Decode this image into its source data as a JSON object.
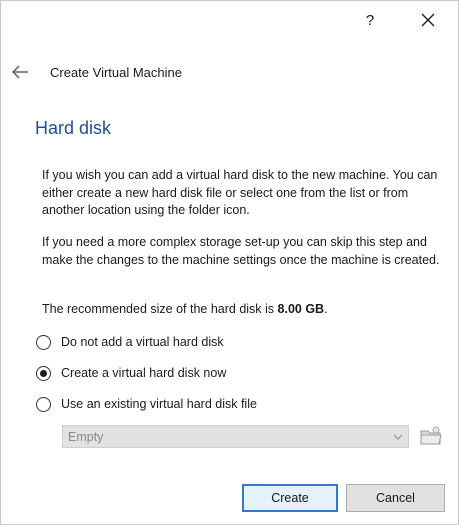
{
  "titlebar": {
    "help_label": "?",
    "close_label": "✕"
  },
  "nav": {
    "wizard_title": "Create Virtual Machine",
    "back_icon": "arrow-left-icon"
  },
  "page": {
    "heading": "Hard disk",
    "paragraph1": "If you wish you can add a virtual hard disk to the new machine. You can either create a new hard disk file or select one from the list or from another location using the folder icon.",
    "paragraph2": "If you need a more complex storage set-up you can skip this step and make the changes to the machine settings once the machine is created.",
    "recommended_prefix": "The recommended size of the hard disk is ",
    "recommended_size": "8.00 GB",
    "recommended_suffix": "."
  },
  "options": [
    {
      "label": "Do not add a virtual hard disk",
      "checked": false
    },
    {
      "label": "Create a virtual hard disk now",
      "checked": true
    },
    {
      "label": "Use an existing virtual hard disk file",
      "checked": false
    }
  ],
  "existing_disk": {
    "selected_value": "Empty",
    "enabled": false,
    "folder_icon": "folder-icon"
  },
  "buttons": {
    "create_label": "Create",
    "cancel_label": "Cancel"
  },
  "colors": {
    "heading": "#1f4e9c",
    "default_button_border": "#2f7ad6"
  }
}
